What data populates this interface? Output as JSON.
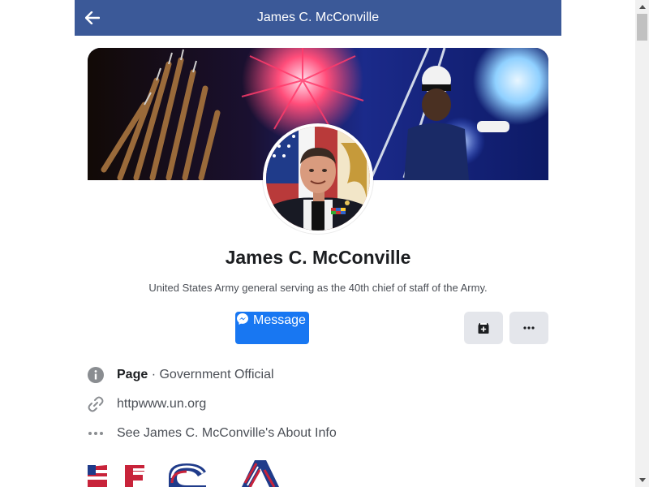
{
  "header": {
    "title": "James C. McConville",
    "bg_color": "#3b5998"
  },
  "profile": {
    "name": "James C. McConville",
    "bio": "United States Army general serving as the 40th chief of staff of the Army."
  },
  "actions": {
    "message_label": "Message",
    "primary_color": "#1877f2"
  },
  "info": {
    "category_bold": "Page",
    "category_sep": " · ",
    "category": "Government Official",
    "website": "httpwww.un.org",
    "about": "See James C. McConville's About Info"
  },
  "icons": {
    "back": "arrow-left-icon",
    "messenger": "messenger-icon",
    "save": "save-icon",
    "more": "more-icon",
    "info": "info-icon",
    "link": "link-icon",
    "ellipsis": "ellipsis-icon"
  }
}
